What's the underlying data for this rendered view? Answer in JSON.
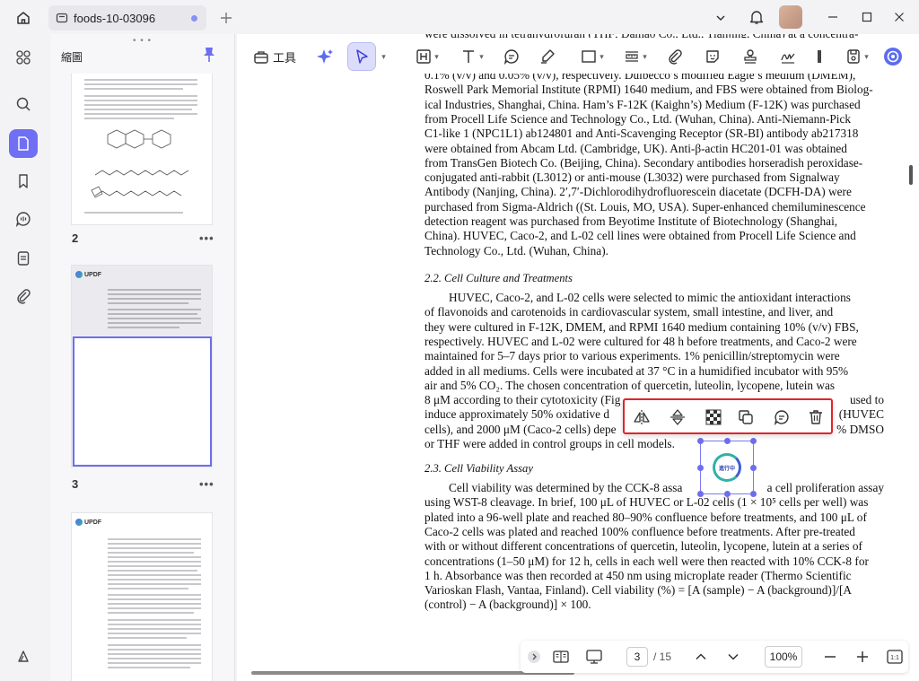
{
  "titlebar": {
    "tab_title": "foods-10-03096"
  },
  "thumbnails": {
    "panel_title": "縮圖",
    "pages": [
      {
        "number": "2",
        "more": "•••"
      },
      {
        "number": "3",
        "more": "•••"
      },
      {
        "number": "",
        "more": ""
      }
    ],
    "brand": "UPDF"
  },
  "toolbar": {
    "tools_label": "工具"
  },
  "document": {
    "top_clip": "were dissolved in tetrahydrofuran (THF; Damao Co., Ltd., Tianjing, China) at a concentra-",
    "para1": [
      "0.1% (v/v) and 0.05% (v/v), respectively. Dulbecco’s modified Eagle’s medium (DMEM),",
      "Roswell Park Memorial Institute (RPMI) 1640 medium, and FBS were obtained from Biolog-",
      "ical Industries, Shanghai, China. Ham’s F-12K (Kaighn’s) Medium (F-12K) was purchased",
      "from Procell Life Science and Technology Co., Ltd. (Wuhan, China). Anti-Niemann-Pick",
      "C1-like 1 (NPC1L1) ab124801 and Anti-Scavenging Receptor (SR-BI) antibody ab217318",
      "were obtained from Abcam Ltd. (Cambridge, UK). Anti-β-actin HC201-01 was obtained",
      "from TransGen Biotech Co. (Beijing, China). Secondary antibodies horseradish peroxidase-",
      "conjugated anti-rabbit (L3012) or anti-mouse (L3032) were purchased from Signalway",
      "Antibody (Nanjing, China). 2′,7′-Dichlorodihydrofluorescein diacetate (DCFH-DA) were",
      "purchased from Sigma-Aldrich ((St. Louis, MO, USA). Super-enhanced chemiluminescence",
      "detection reagent was purchased from Beyotime Institute of Biotechnology (Shanghai,",
      "China). HUVEC, Caco-2, and L-02 cell lines were obtained from Procell Life Science and",
      "Technology Co., Ltd. (Wuhan, China)."
    ],
    "heading2": "2.2. Cell Culture and Treatments",
    "para2": [
      "HUVEC, Caco-2, and L-02 cells were selected to mimic the antioxidant interactions",
      "of flavonoids and carotenoids in cardiovascular system, small intestine, and liver, and",
      "they were cultured in F-12K, DMEM, and RPMI 1640 medium containing 10% (v/v) FBS,",
      "respectively. HUVEC and L-02 were cultured for 48 h before treatments, and Caco-2 were",
      "maintained for 5–7 days prior to various experiments. 1% penicillin/streptomycin were",
      "added in all mediums. Cells were incubated at 37 °C in a humidified incubator with 95%",
      "air and 5% CO₂. The chosen concentration of quercetin, luteolin, lycopene, lutein was",
      "8 μM according to their cytotoxicity (Fig",
      "induce approximately 50% oxidative d",
      "cells), and 2000 μM (Caco-2 cells) depe",
      "or THF were added in control groups in cell models."
    ],
    "para2_right": [
      "",
      "",
      "",
      "",
      "",
      "",
      "",
      "used to",
      "(HUVEC",
      "% DMSO",
      ""
    ],
    "heading3": "2.3. Cell Viability Assay",
    "para3": [
      "Cell viability was determined by the CCK-8 assa",
      "using WST-8 cleavage. In brief, 100 μL of HUVEC or L-02 cells (1 × 10⁵ cells per well) was",
      "plated into a 96-well plate and reached 80–90% confluence before treatments, and 100 μL of",
      "Caco-2 cells was plated and reached 100% confluence before treatments. After pre-treated",
      "with or without different concentrations of quercetin, luteolin, lycopene, lutein at a series of",
      "concentrations (1–50 μM) for 12 h, cells in each well were then reacted with 10% CCK-8 for",
      "1 h. Absorbance was then recorded at 450 nm using microplate reader (Thermo Scientific",
      "Varioskan Flash, Vantaa, Finland). Cell viability (%) = [A (sample) − A (background)]/[A",
      "(control) − A (background)] × 100."
    ],
    "para3_right_first": "a cell proliferation assay"
  },
  "selected_image": {
    "badge_text": "進行中"
  },
  "bottombar": {
    "current_page": "3",
    "total_pages": "/ 15",
    "zoom": "100%"
  }
}
